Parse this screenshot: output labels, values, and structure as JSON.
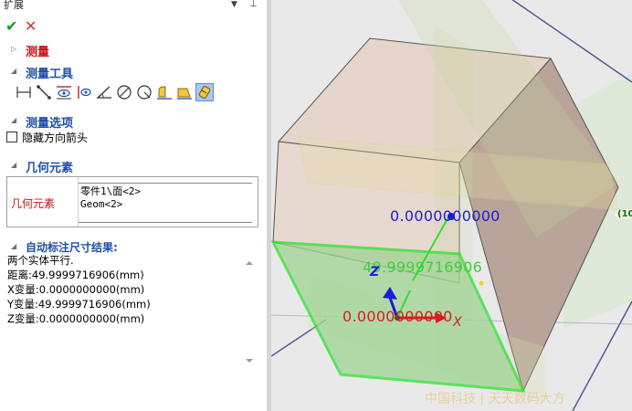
{
  "panel": {
    "title": "扩展",
    "menu_glyph": "▼",
    "pin_glyph": "⊥"
  },
  "actions": {
    "ok": "✔",
    "cancel": "✕"
  },
  "sections": {
    "measure": "测量",
    "measure_tools": "测量工具",
    "measure_options": "测量选项",
    "geometry": "几何元素",
    "result": "自动标注尺寸结果:"
  },
  "tools": [
    {
      "icon": "distance-icon",
      "active": false
    },
    {
      "icon": "edge-length-icon",
      "active": false
    },
    {
      "icon": "eye-distance-icon",
      "active": false
    },
    {
      "icon": "eye-point-icon",
      "active": false
    },
    {
      "icon": "angle-icon",
      "active": false
    },
    {
      "icon": "circle-diameter-icon",
      "active": false
    },
    {
      "icon": "circle-radius-icon",
      "active": false
    },
    {
      "icon": "area-icon",
      "active": false
    },
    {
      "icon": "surface-area-icon",
      "active": false
    },
    {
      "icon": "auto-dimension-icon",
      "active": true
    }
  ],
  "options": {
    "hide_arrow_label": "隐藏方向箭头",
    "hide_arrow_checked": false
  },
  "geometry": {
    "label": "几何元素",
    "items": [
      "零件1\\面<2>",
      "Geom<2>"
    ]
  },
  "results": [
    "两个实体平行.",
    "距离:49.9999716906(mm)",
    "X变量:0.0000000000(mm)",
    "Y变量:49.9999716906(mm)",
    "Z变量:0.0000000000(mm)"
  ],
  "viewport": {
    "dim_z": "0.0000000000",
    "dim_y": "49.9999716906",
    "dim_x": "0.0000000000",
    "axis_z": "Z",
    "axis_x": "X",
    "side_tag": "(10",
    "watermark": "中国科技  | 天天数码大方"
  },
  "colors": {
    "accent_blue": "#1f4fa8",
    "alert_red": "#c81414",
    "ok_green": "#1a9a1a",
    "highlight_green": "#2ee02e",
    "dim_blue": "#1c1cd8",
    "dim_red": "#d81c1c"
  }
}
